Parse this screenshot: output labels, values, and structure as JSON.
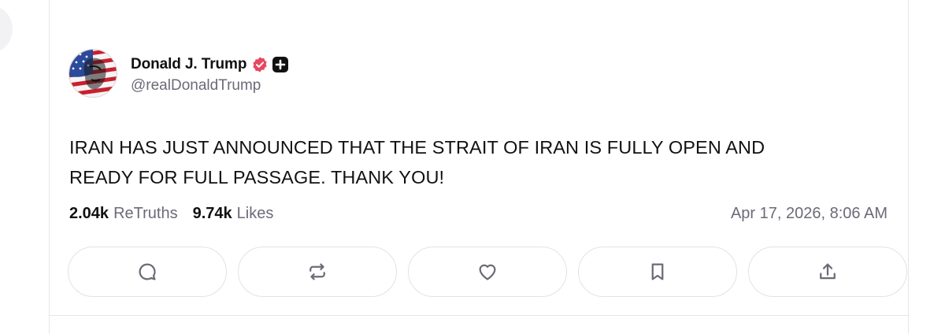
{
  "post": {
    "author": {
      "display_name": "Donald J. Trump",
      "handle": "@realDonaldTrump",
      "verified_icon": "verified-badge-icon",
      "badge_icon": "plus-badge-icon"
    },
    "text_line1": "IRAN HAS JUST ANNOUNCED THAT THE STRAIT OF IRAN IS FULLY OPEN AND",
    "text_line2": "READY FOR FULL PASSAGE. THANK YOU!",
    "stats": {
      "retruths_count": "2.04k",
      "retruths_label": "ReTruths",
      "likes_count": "9.74k",
      "likes_label": "Likes"
    },
    "timestamp": "Apr 17, 2026, 8:06 AM",
    "actions": [
      {
        "icon": "reply-icon"
      },
      {
        "icon": "retruth-icon"
      },
      {
        "icon": "like-heart-icon"
      },
      {
        "icon": "bookmark-icon"
      },
      {
        "icon": "share-icon"
      }
    ]
  },
  "colors": {
    "verified": "#e8485f",
    "text_primary": "#111111",
    "text_secondary": "#6b6b78",
    "border": "#e3e3e8"
  }
}
